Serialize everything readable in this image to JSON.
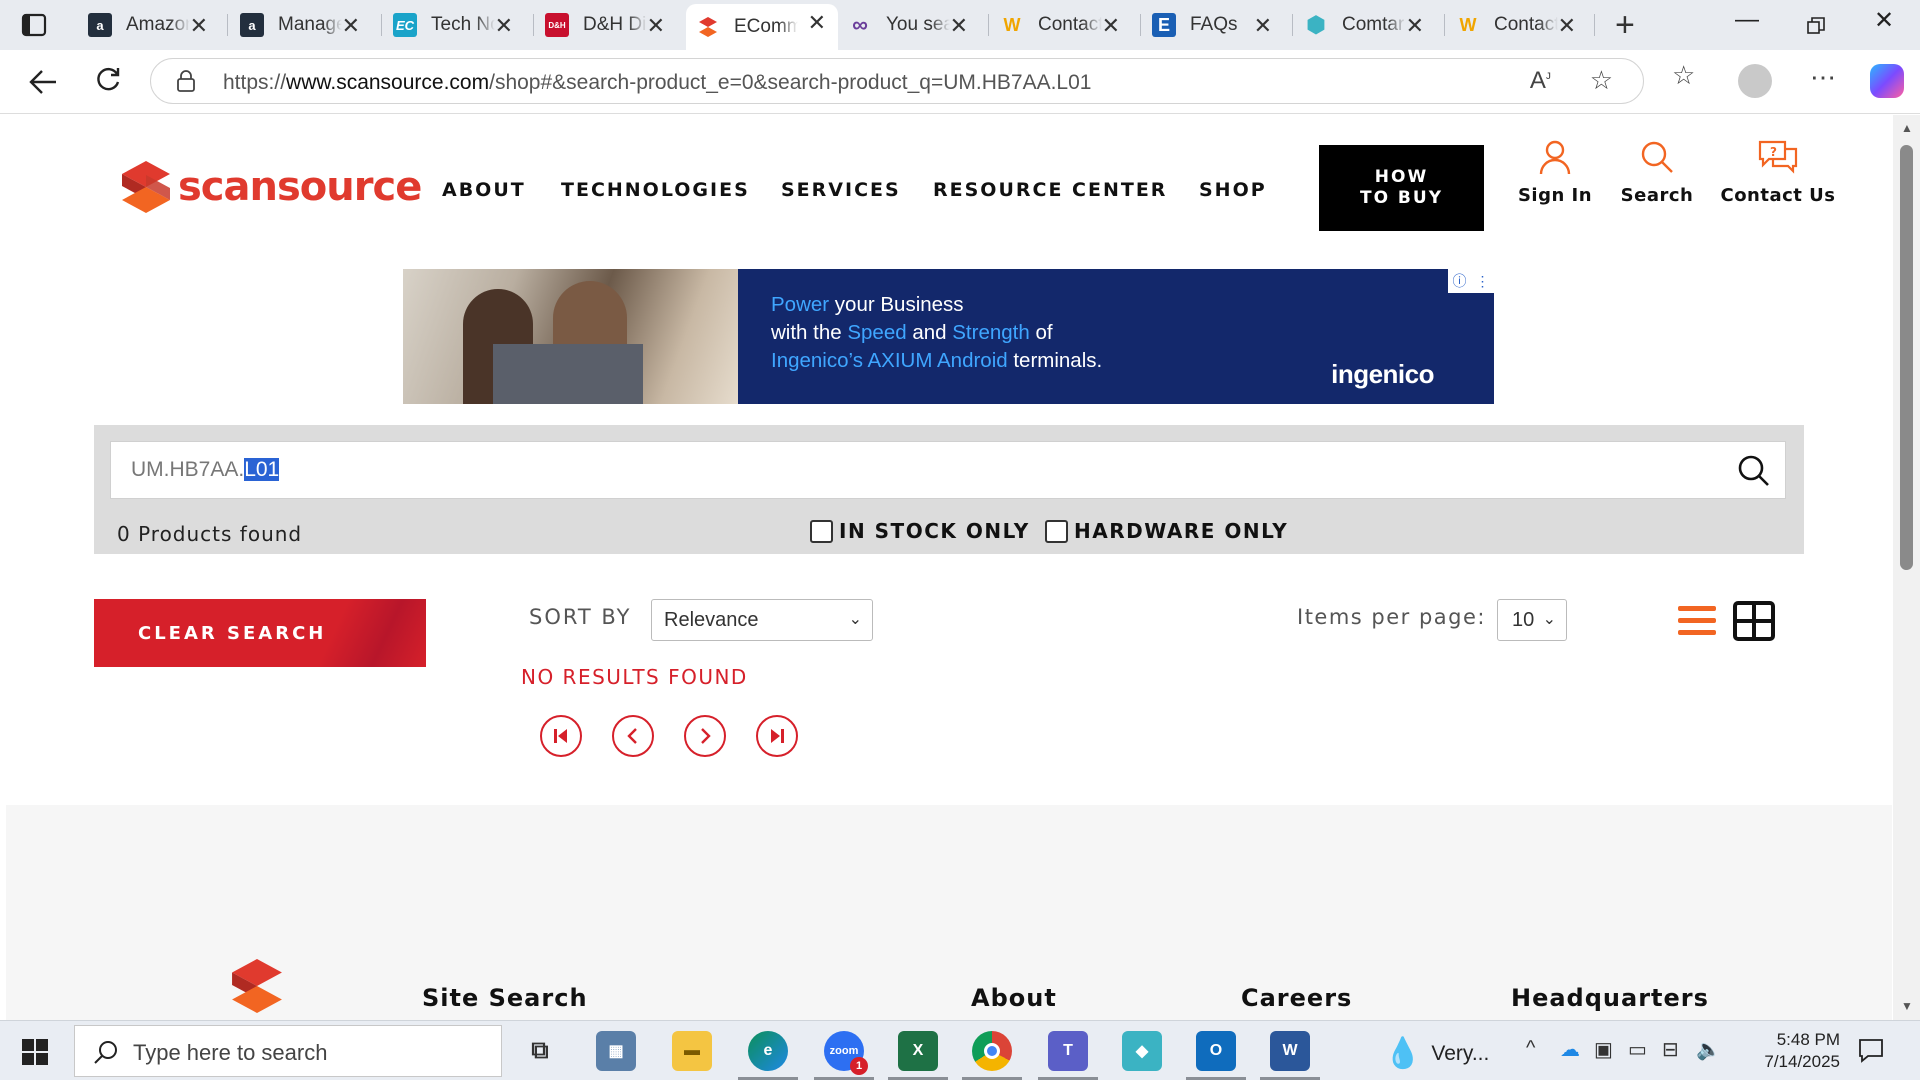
{
  "browser": {
    "tabs": [
      {
        "label": "Amazon",
        "fav": "a",
        "fav_color": "#232f3e"
      },
      {
        "label": "Manage",
        "fav": "a",
        "fav_color": "#232f3e"
      },
      {
        "label": "Tech Notes",
        "fav": "EC",
        "fav_color": "#1aa3c9"
      },
      {
        "label": "D&H Distributing",
        "fav": "D&H",
        "fav_color": "#c8102e"
      },
      {
        "label": "EComm",
        "fav": "S",
        "fav_color": "#e03a2e"
      },
      {
        "label": "You searched",
        "fav": "∞",
        "fav_color": "#6a3d9a"
      },
      {
        "label": "Contact",
        "fav": "W",
        "fav_color": "#f0a500"
      },
      {
        "label": "FAQs",
        "fav": "E",
        "fav_color": "#1a5fb4"
      },
      {
        "label": "Comtar",
        "fav": "◆",
        "fav_color": "#3bb3c3"
      },
      {
        "label": "Contact",
        "fav": "W",
        "fav_color": "#f0a500"
      }
    ],
    "url_prefix": "https://",
    "url_domain": "www.scansource.com",
    "url_path": "/shop#&search-product_e=0&search-product_q=UM.HB7AA.L01"
  },
  "site": {
    "logo_text": "scansource",
    "nav": [
      "ABOUT",
      "TECHNOLOGIES",
      "SERVICES",
      "RESOURCE CENTER",
      "SHOP"
    ],
    "how_to_buy_line1": "HOW",
    "how_to_buy_line2": "TO BUY",
    "sign_in": "Sign In",
    "search": "Search",
    "contact_us": "Contact Us"
  },
  "banner": {
    "line1_hl": "Power",
    "line1_rest": " your Business",
    "line2_a": "with the ",
    "line2_hl1": "Speed",
    "line2_b": " and ",
    "line2_hl2": "Strength",
    "line2_c": " of",
    "line3_hl": "Ingenico’s AXIUM Android",
    "line3_rest": " terminals.",
    "brand": "ingenico"
  },
  "search": {
    "query_prefix": "UM.HB7AA.",
    "query_selected": "L01",
    "results_count": "0 Products found",
    "in_stock_label": "IN STOCK ONLY",
    "hardware_label": "HARDWARE ONLY",
    "in_stock_checked": false,
    "hardware_checked": false
  },
  "results": {
    "clear_label": "CLEAR SEARCH",
    "sort_label": "SORT BY",
    "sort_value": "Relevance",
    "items_per_page_label": "Items per page:",
    "items_per_page_value": "10",
    "no_results": "NO RESULTS FOUND"
  },
  "footer": {
    "headings": [
      "Site Search",
      "About",
      "Careers",
      "Headquarters"
    ]
  },
  "taskbar": {
    "search_placeholder": "Type here to search",
    "weather": "Very...",
    "time": "5:48 PM",
    "date": "7/14/2025",
    "zoom_badge": "1"
  },
  "colors": {
    "brand_red": "#d6202a",
    "brand_orange": "#f26522",
    "banner_navy": "#13286b"
  }
}
